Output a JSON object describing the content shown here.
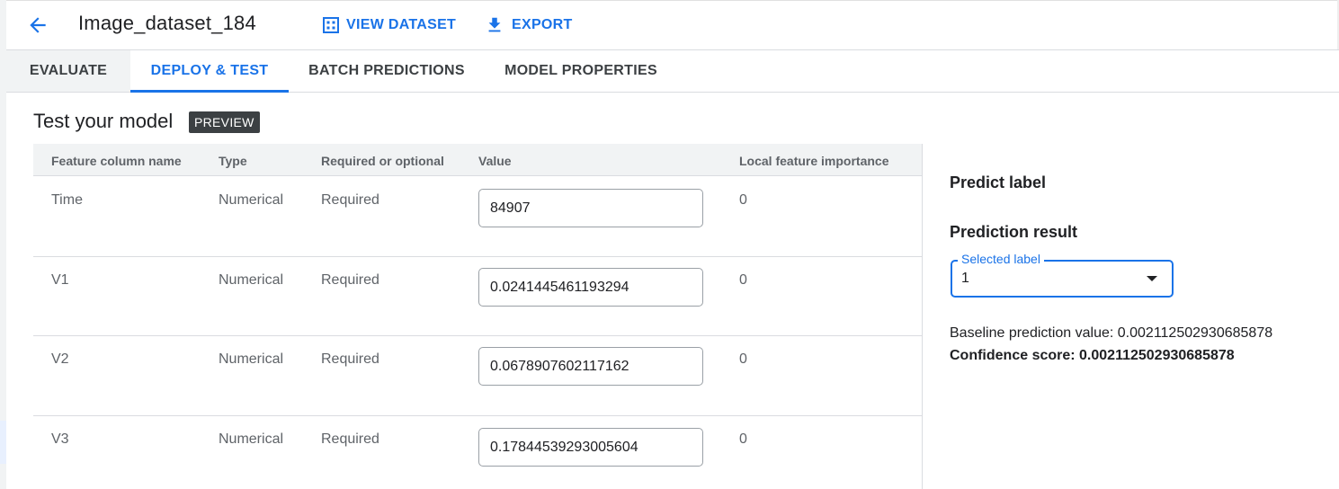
{
  "header": {
    "title": "Image_dataset_184",
    "view_dataset_label": "VIEW DATASET",
    "export_label": "EXPORT"
  },
  "tabs": [
    {
      "label": "EVALUATE",
      "active": false
    },
    {
      "label": "DEPLOY & TEST",
      "active": true
    },
    {
      "label": "BATCH PREDICTIONS",
      "active": false
    },
    {
      "label": "MODEL PROPERTIES",
      "active": false
    }
  ],
  "section": {
    "title": "Test your model",
    "badge": "PREVIEW"
  },
  "table": {
    "headers": [
      "Feature column name",
      "Type",
      "Required or optional",
      "Value",
      "Local feature importance"
    ],
    "rows": [
      {
        "name": "Time",
        "type": "Numerical",
        "required": "Required",
        "value": "84907",
        "importance": "0"
      },
      {
        "name": "V1",
        "type": "Numerical",
        "required": "Required",
        "value": "0.0241445461193294",
        "importance": "0"
      },
      {
        "name": "V2",
        "type": "Numerical",
        "required": "Required",
        "value": "0.0678907602117162",
        "importance": "0"
      },
      {
        "name": "V3",
        "type": "Numerical",
        "required": "Required",
        "value": "0.17844539293005604",
        "importance": "0"
      }
    ]
  },
  "panel": {
    "predict_label_heading": "Predict label",
    "prediction_result_heading": "Prediction result",
    "select_label": "Selected label",
    "select_value": "1",
    "baseline_text": "Baseline prediction value: 0.002112502930685878",
    "confidence_text": "Confidence score: 0.002112502930685878"
  },
  "colors": {
    "accent": "#1a73e8",
    "badge_bg": "#3c4043",
    "header_bg": "#f1f3f4"
  },
  "icons": {
    "back": "arrow-left-icon",
    "view_dataset": "grid-icon",
    "export": "download-icon",
    "dropdown": "caret-down-icon"
  }
}
